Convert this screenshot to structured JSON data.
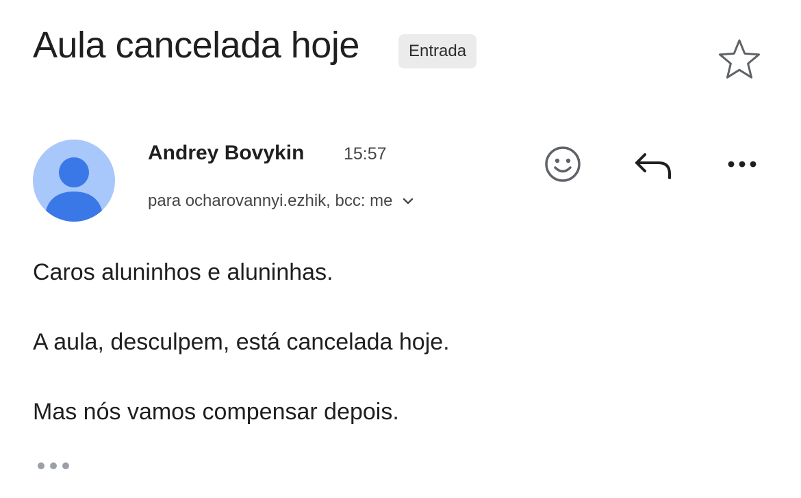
{
  "email": {
    "subject": "Aula cancelada hoje",
    "label": "Entrada",
    "sender": "Andrey Bovykin",
    "time": "15:57",
    "recipients": "para ocharovannyi.ezhik, bcc: me",
    "body": [
      "Caros aluninhos e aluninhas.",
      "A aula, desculpem, está cancelada hoje.",
      "Mas nós vamos compensar depois."
    ]
  },
  "icons": {
    "star": "star-outline-icon",
    "emoji": "smiley-icon",
    "reply": "reply-arrow-icon",
    "more": "more-horizontal-icon",
    "expand": "chevron-down-icon",
    "trimmed": "show-trimmed-content-icon"
  },
  "colors": {
    "avatar_bg": "#a8c7fa",
    "avatar_fg": "#3b78e7",
    "chip_bg": "#ebebeb",
    "text_primary": "#1f1f1f",
    "text_secondary": "#444746"
  }
}
